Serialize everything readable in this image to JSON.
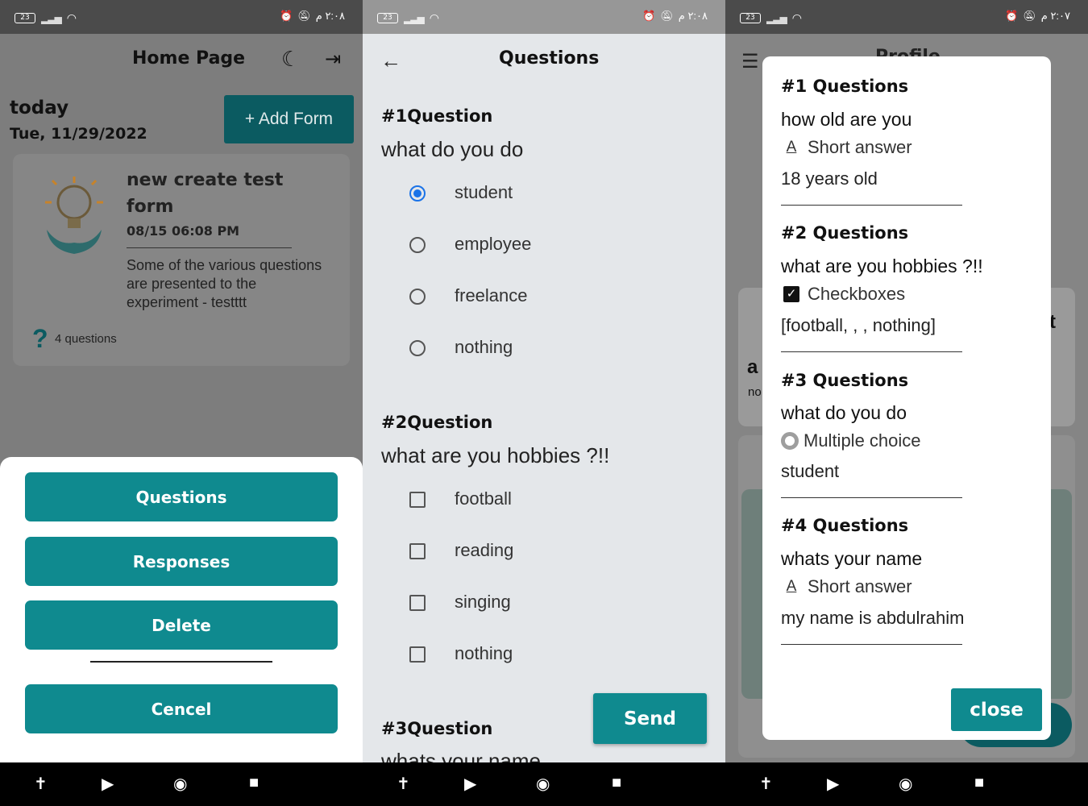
{
  "status": {
    "battery": "23",
    "time_1": "٢:٠٨ م",
    "time_2": "٢:٠٨ م",
    "time_3": "٢:٠٧ م"
  },
  "home": {
    "title": "Home Page",
    "today_label": "today",
    "date": "Tue, 11/29/2022",
    "add_form_label": "+ Add Form",
    "card": {
      "title": "new create test form",
      "datetime": "08/15 06:08 PM",
      "description": "Some of the various questions are presented to the experiment - testttt",
      "question_count": "4 questions"
    },
    "sheet": {
      "questions_label": "Questions",
      "responses_label": "Responses",
      "delete_label": "Delete",
      "cancel_label": "Cencel"
    }
  },
  "questions_screen": {
    "title": "Questions",
    "q1": {
      "heading": "#1Question",
      "text": "what do you do",
      "options": [
        "student",
        "employee",
        "freelance",
        "nothing"
      ]
    },
    "q2": {
      "heading": "#2Question",
      "text": "what are you hobbies ?!!",
      "options": [
        "football",
        "reading",
        "singing",
        "nothing"
      ]
    },
    "q3": {
      "heading": "#3Question",
      "text": "whats your name"
    },
    "send_label": "Send"
  },
  "profile": {
    "title": "Profile",
    "behind_letter_a": "a",
    "behind_text_no": "no",
    "behind_letter_t": "t",
    "dialog": {
      "items": [
        {
          "heading": "#1 Questions",
          "question": "how old are you",
          "type": "Short answer",
          "answer": "18 years old"
        },
        {
          "heading": "#2 Questions",
          "question": "what are you hobbies ?!!",
          "type": "Checkboxes",
          "answer": "[football, , , nothing]"
        },
        {
          "heading": "#3 Questions",
          "question": "what do you do",
          "type": "Multiple choice",
          "answer": "student"
        },
        {
          "heading": "#4 Questions",
          "question": "whats your name",
          "type": "Short answer",
          "answer": "my name is abdulrahim"
        }
      ],
      "close_label": "close"
    }
  },
  "icons": {
    "nav_accessibility": "accessibility-icon",
    "nav_back": "play-icon",
    "nav_home": "circle-icon",
    "nav_recent": "square-icon"
  },
  "colors": {
    "teal_primary": "#0f8a8f",
    "teal_dark": "#0b5b61",
    "radio_selected": "#1a73e8"
  }
}
